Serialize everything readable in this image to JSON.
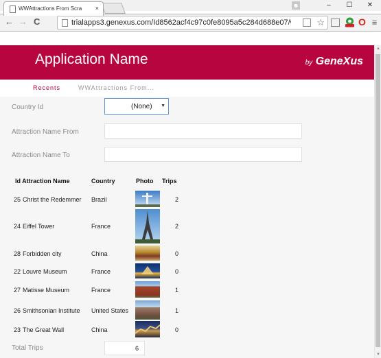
{
  "browser": {
    "tab_title": "WWAttractions From Scra",
    "tab_close": "×",
    "url": "trialapps3.genexus.com/Id8562acf4c97c0fe8095a5c284d688e07/ww",
    "controls": {
      "minimize": "–",
      "maximize": "☐",
      "close": "✕"
    },
    "nav": {
      "back": "←",
      "forward": "→",
      "reload": "C"
    },
    "bookmark_star": "☆",
    "ext_new_badge": "NEW"
  },
  "app": {
    "title": "Application Name",
    "brand_by": "by",
    "brand_name": "GeneXus",
    "header_color": "#b7063f"
  },
  "breadcrumb": {
    "recents": "Recents",
    "current": "WWAttractions From..."
  },
  "filters": {
    "country_label": "Country Id",
    "country_value": "(None)",
    "name_from_label": "Attraction Name From",
    "name_from_value": "",
    "name_to_label": "Attraction Name To",
    "name_to_value": ""
  },
  "grid": {
    "headers": {
      "id_name": "Id Attraction Name",
      "country": "Country",
      "photo": "Photo",
      "trips": "Trips"
    },
    "rows": [
      {
        "id": "25",
        "name": "Christ the Redemmer",
        "country": "Brazil",
        "trips": "2",
        "photo": "christ-redeemer-photo"
      },
      {
        "id": "24",
        "name": "Eiffel Tower",
        "country": "France",
        "trips": "2",
        "photo": "eiffel-tower-photo"
      },
      {
        "id": "28",
        "name": "Forbidden city",
        "country": "China",
        "trips": "0",
        "photo": "forbidden-city-photo"
      },
      {
        "id": "22",
        "name": "Louvre Museum",
        "country": "France",
        "trips": "0",
        "photo": "louvre-photo"
      },
      {
        "id": "27",
        "name": "Matisse Museum",
        "country": "France",
        "trips": "1",
        "photo": "matisse-museum-photo"
      },
      {
        "id": "26",
        "name": "Smithsonian Institute",
        "country": "United States",
        "trips": "1",
        "photo": "smithsonian-photo"
      },
      {
        "id": "23",
        "name": "The Great Wall",
        "country": "China",
        "trips": "0",
        "photo": "great-wall-photo"
      }
    ]
  },
  "total": {
    "label": "Total Trips",
    "value": "6"
  }
}
